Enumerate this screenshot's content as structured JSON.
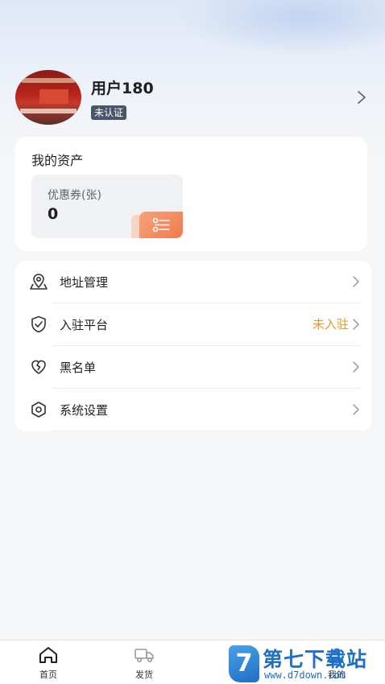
{
  "profile": {
    "username": "用户180",
    "badge": "未认证"
  },
  "assets": {
    "title": "我的资产",
    "coupon_label": "优惠券(张)",
    "coupon_value": "0"
  },
  "menu": {
    "items": [
      {
        "label": "地址管理",
        "value": "",
        "icon": "map-pin-icon"
      },
      {
        "label": "入驻平台",
        "value": "未入驻",
        "icon": "shield-check-icon"
      },
      {
        "label": "黑名单",
        "value": "",
        "icon": "broken-heart-icon"
      },
      {
        "label": "系统设置",
        "value": "",
        "icon": "settings-hex-icon"
      }
    ]
  },
  "tabs": [
    {
      "label": "首页",
      "icon": "home-icon"
    },
    {
      "label": "发货",
      "icon": "truck-icon"
    },
    {
      "label": "我的",
      "icon": "user-icon"
    }
  ],
  "colors": {
    "accent_orange": "#f07b4e",
    "status_value": "#e39a2b",
    "badge_bg": "#4b5569"
  },
  "watermark": {
    "logo": "7",
    "title": "第七下载站",
    "url": "www.d7down.com"
  }
}
